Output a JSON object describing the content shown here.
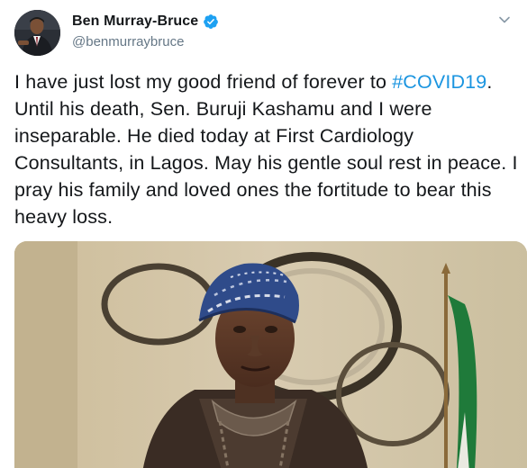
{
  "author": {
    "display_name": "Ben Murray-Bruce",
    "handle": "@benmurraybruce",
    "verified": true,
    "avatar_icon": "profile-photo"
  },
  "tweet": {
    "text_before": "I have just lost my good friend of forever to ",
    "hashtag": "#COVID19",
    "text_after": ". Until his death, Sen. Buruji Kashamu and I were inseparable. He died today at First Cardiology Consultants, in Lagos. May his gentle soul rest in peace. I pray his family and loved ones the fortitude to bear this heavy loss."
  },
  "colors": {
    "hashtag": "#1b95e0",
    "verified_badge": "#1da1f2",
    "handle": "#657786",
    "text": "#14171a"
  },
  "icons": {
    "verified": "verified-badge-icon",
    "menu": "chevron-down-icon"
  },
  "media": {
    "type": "photo",
    "description_icon": "attached-photo"
  }
}
